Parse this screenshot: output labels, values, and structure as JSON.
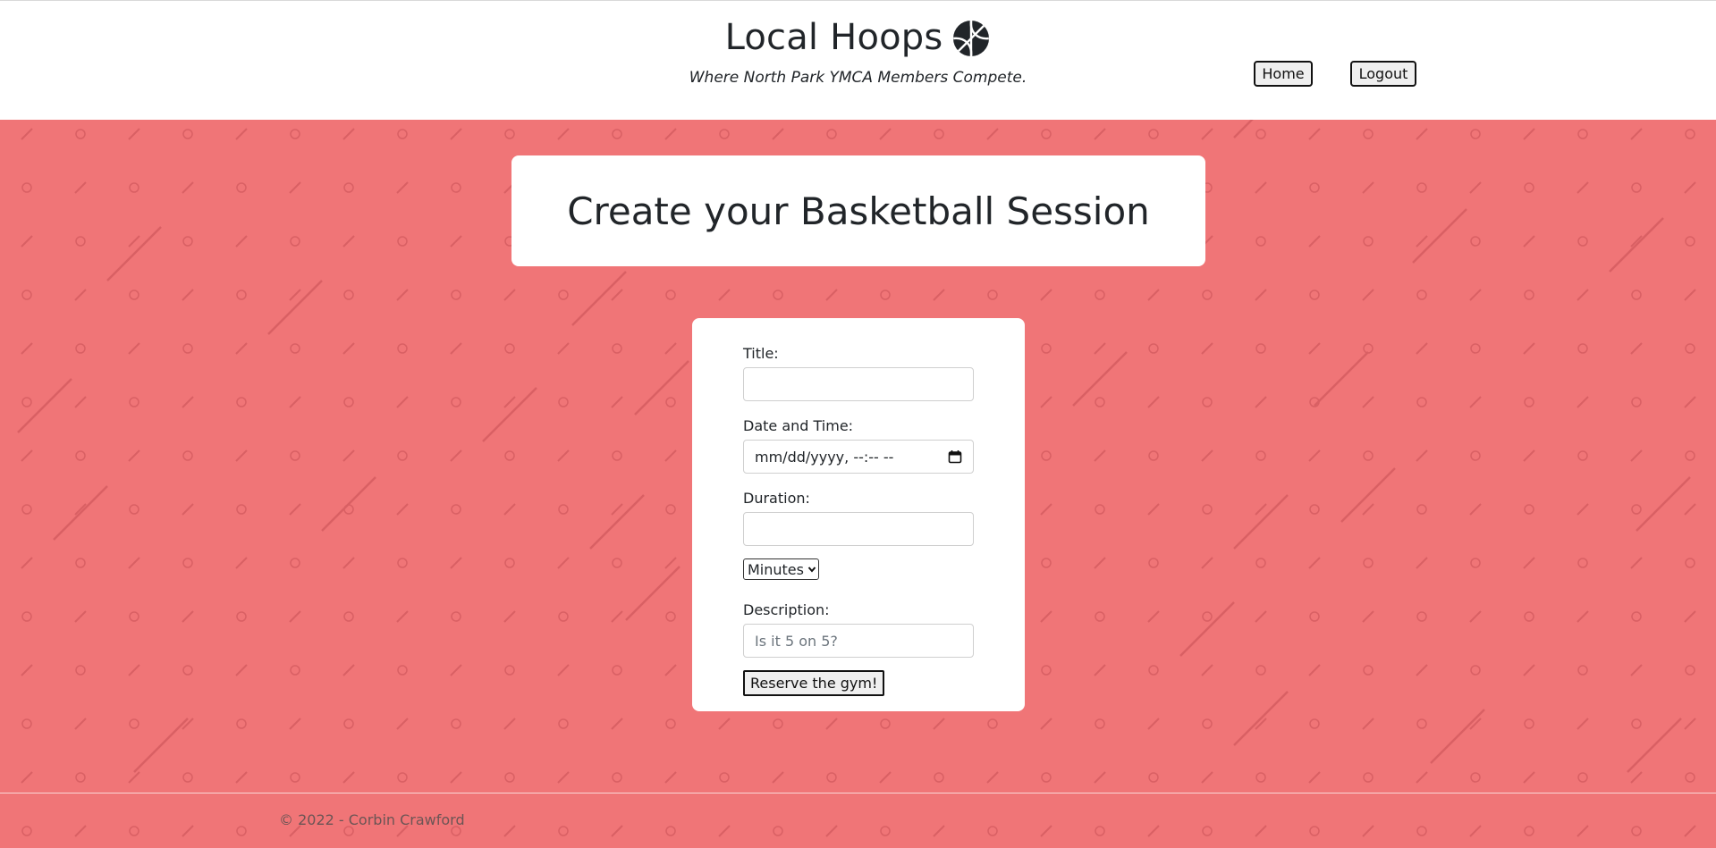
{
  "header": {
    "title": "Local Hoops",
    "tagline": "Where North Park YMCA Members Compete.",
    "nav": {
      "home_label": "Home",
      "logout_label": "Logout"
    }
  },
  "page": {
    "heading": "Create your Basketball Session"
  },
  "form": {
    "title_label": "Title:",
    "title_value": "",
    "datetime_label": "Date and Time:",
    "datetime_placeholder": "mm/dd/yyyy, --:-- --",
    "duration_label": "Duration:",
    "duration_value": "",
    "duration_unit_selected": "Minutes",
    "description_label": "Description:",
    "description_placeholder": "Is it 5 on 5?",
    "submit_label": "Reserve the gym!"
  },
  "footer": {
    "copyright": "© 2022 - Corbin Crawford"
  },
  "colors": {
    "background": "#f07577",
    "pattern": "#d96064",
    "card": "#ffffff",
    "text": "#212529"
  },
  "icons": {
    "brand": "basketball-icon",
    "date": "calendar-icon",
    "select": "chevron-down-icon"
  }
}
